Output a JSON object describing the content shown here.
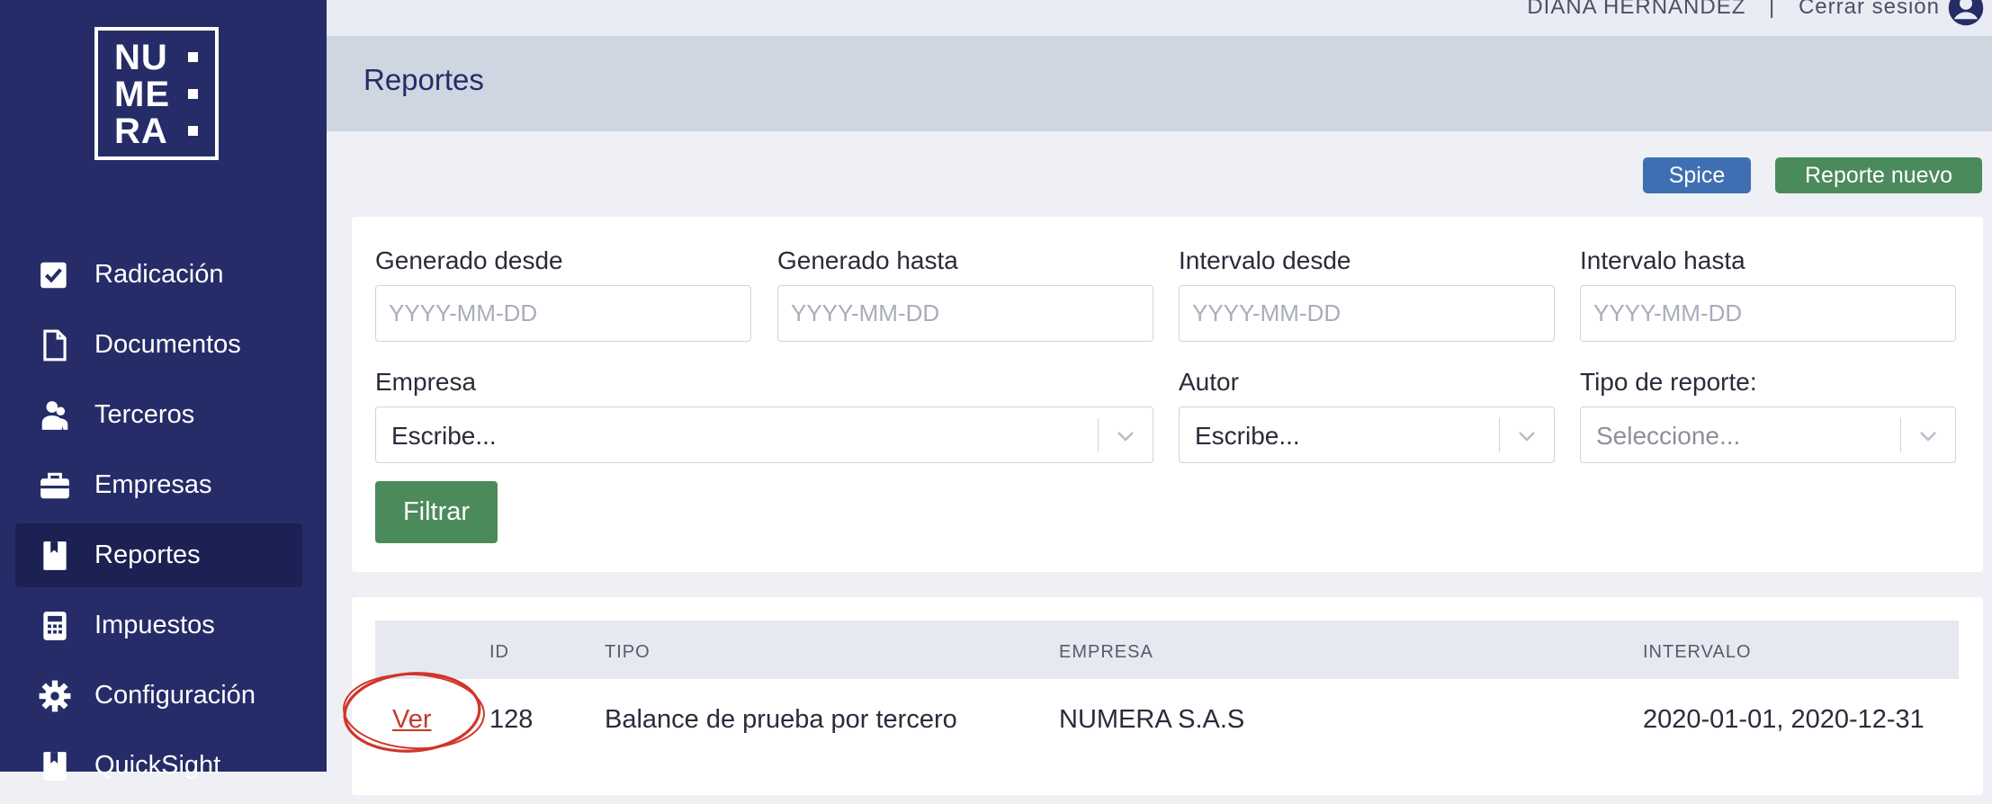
{
  "app": {
    "brand_lines": [
      "NU",
      "ME",
      "RA"
    ]
  },
  "sidebar": {
    "items": [
      {
        "label": "Radicación",
        "icon": "checkbox-icon"
      },
      {
        "label": "Documentos",
        "icon": "document-icon"
      },
      {
        "label": "Terceros",
        "icon": "users-icon"
      },
      {
        "label": "Empresas",
        "icon": "briefcase-icon"
      },
      {
        "label": "Reportes",
        "icon": "book-icon",
        "active": true
      },
      {
        "label": "Impuestos",
        "icon": "calculator-icon"
      },
      {
        "label": "Configuración",
        "icon": "gear-icon"
      },
      {
        "label": "QuickSight",
        "icon": "book-icon"
      }
    ]
  },
  "topbar": {
    "user_name": "DIANA HERNÁNDEZ",
    "separator": "|",
    "logout_label": "Cerrar sesión"
  },
  "page": {
    "title": "Reportes"
  },
  "actions": {
    "spice_label": "Spice",
    "new_report_label": "Reporte nuevo"
  },
  "filters": {
    "generated_from": {
      "label": "Generado desde",
      "placeholder": "YYYY-MM-DD",
      "value": ""
    },
    "generated_to": {
      "label": "Generado hasta",
      "placeholder": "YYYY-MM-DD",
      "value": ""
    },
    "interval_from": {
      "label": "Intervalo desde",
      "placeholder": "YYYY-MM-DD",
      "value": ""
    },
    "interval_to": {
      "label": "Intervalo hasta",
      "placeholder": "YYYY-MM-DD",
      "value": ""
    },
    "company": {
      "label": "Empresa",
      "value": "Escribe..."
    },
    "author": {
      "label": "Autor",
      "value": "Escribe..."
    },
    "report_type": {
      "label": "Tipo de reporte:",
      "value": "Seleccione..."
    },
    "filter_button": "Filtrar"
  },
  "table": {
    "columns": [
      "ID",
      "TIPO",
      "EMPRESA",
      "INTERVALO"
    ],
    "rows": [
      {
        "action": "Ver",
        "id": "128",
        "tipo": "Balance de prueba por tercero",
        "empresa": "NUMERA S.A.S",
        "intervalo": "2020-01-01, 2020-12-31"
      }
    ]
  },
  "colors": {
    "sidebar_bg": "#262c68",
    "primary_green": "#4b8a5a",
    "spice_blue": "#3f6fb2",
    "annotation_red": "#d0352a"
  }
}
